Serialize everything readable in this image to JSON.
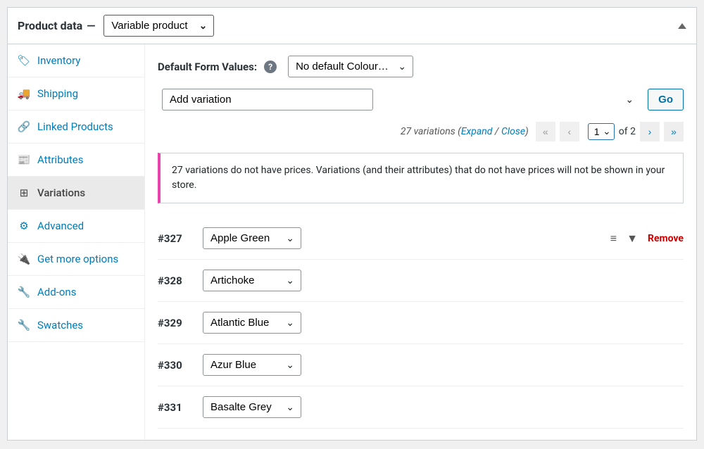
{
  "header": {
    "title": "Product data",
    "dash": "—",
    "product_type": "Variable product"
  },
  "sidebar": {
    "items": [
      {
        "label": "Inventory",
        "icon": "🏷"
      },
      {
        "label": "Shipping",
        "icon": "🚚"
      },
      {
        "label": "Linked Products",
        "icon": "🔗"
      },
      {
        "label": "Attributes",
        "icon": "📰"
      },
      {
        "label": "Variations",
        "icon": "⊞"
      },
      {
        "label": "Advanced",
        "icon": "⚙"
      },
      {
        "label": "Get more options",
        "icon": "🔌"
      },
      {
        "label": "Add-ons",
        "icon": "🔧"
      },
      {
        "label": "Swatches",
        "icon": "🔧"
      }
    ]
  },
  "defaults": {
    "label": "Default Form Values:",
    "selected": "No default Colour…"
  },
  "toolbar": {
    "add_variation": "Add variation",
    "go": "Go"
  },
  "pager": {
    "count_text": "27 variations",
    "expand": "Expand",
    "close": "Close",
    "page": "1",
    "of_label": "of",
    "total": "2"
  },
  "notice": "27 variations do not have prices. Variations (and their attributes) that do not have prices will not be shown in your store.",
  "variations": [
    {
      "id": "#327",
      "attr": "Apple Green",
      "show_actions": true
    },
    {
      "id": "#328",
      "attr": "Artichoke",
      "show_actions": false
    },
    {
      "id": "#329",
      "attr": "Atlantic Blue",
      "show_actions": false
    },
    {
      "id": "#330",
      "attr": "Azur Blue",
      "show_actions": false
    },
    {
      "id": "#331",
      "attr": "Basalte Grey",
      "show_actions": false
    }
  ],
  "actions": {
    "remove": "Remove"
  }
}
